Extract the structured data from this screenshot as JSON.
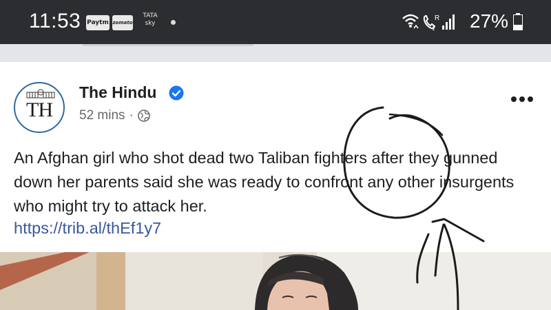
{
  "status_bar": {
    "time": "11:53",
    "app_icons": [
      "Paytm",
      "zomato"
    ],
    "tata_sky": [
      "TATA",
      "sky"
    ],
    "battery": "27%",
    "icons": [
      "wifi-icon",
      "call-signal-icon",
      "signal-bars-icon",
      "battery-icon"
    ]
  },
  "post": {
    "page_name": "The Hindu",
    "avatar_initials": "TH",
    "time_ago": "52 mins",
    "separator": "·",
    "text": "An Afghan girl who shot dead two Taliban fighters after they gunned down her parents said she was ready to confront any other insurgents who might try to attack her.",
    "link": "https://trib.al/thEf1y7"
  },
  "colors": {
    "status_bar_bg": "#2b2d30",
    "verified_blue": "#1877f2",
    "link_blue": "#385898",
    "meta_gray": "#65676b"
  }
}
